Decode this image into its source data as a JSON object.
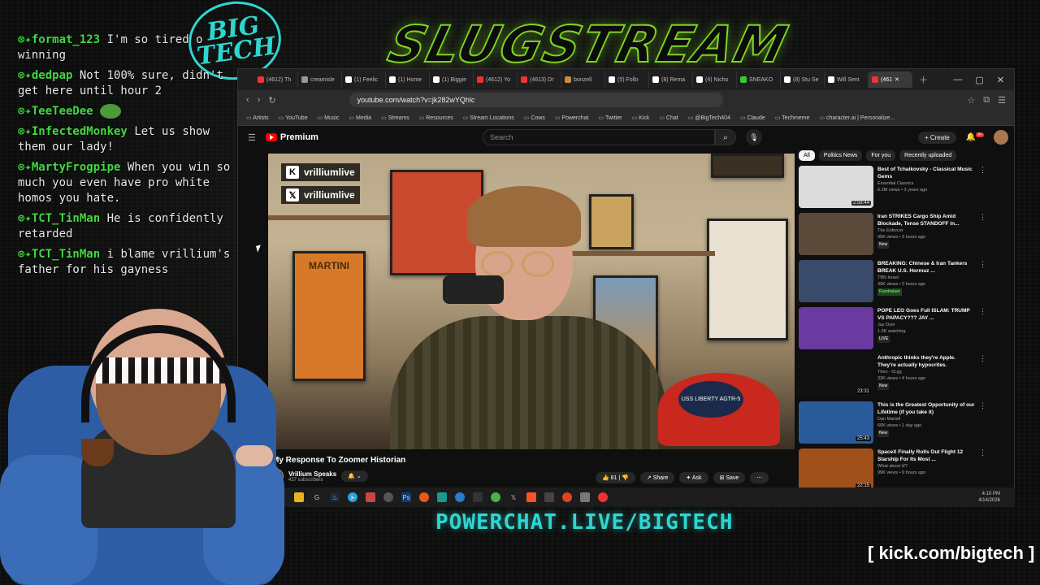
{
  "overlay": {
    "stream_title": "SLUGSTREAM",
    "logo_text": "BIG\nTECH",
    "powerchat": "POWERCHAT.LIVE/BIGTECH",
    "kick": "[ kick.com/bigtech ]"
  },
  "chat": [
    {
      "user": "format_123",
      "text": "I'm so tired o winning"
    },
    {
      "user": "dedpap",
      "text": "Not 100% sure, didn't get here until hour 2"
    },
    {
      "user": "TeeTeeDee",
      "text": ""
    },
    {
      "user": "InfectedMonkey",
      "text": "Let us show them our lady!"
    },
    {
      "user": "MartyFrogpipe",
      "text": "When you win so much you even have pro white homos you hate."
    },
    {
      "user": "TCT_TinMan",
      "text": "He is confidently retarded"
    },
    {
      "user": "TCT_TinMan",
      "text": "i blame vrillium's father for his gayness"
    }
  ],
  "browser": {
    "tabs": [
      "(4612) Th",
      "creamisle",
      "(1) Feelic",
      "(1) Home",
      "(1) Biggie",
      "(4612) Yo",
      "(4613) Dr",
      "bonzell",
      "(5) Follo",
      "(8) Rema",
      "(4) Nicho",
      "SNEAKO",
      "(8) Stu Se",
      "Will Sent",
      "(461"
    ],
    "url": "youtube.com/watch?v=jk282wYQhlc",
    "bookmarks": [
      "Artists",
      "YouTube",
      "Music",
      "Media",
      "Streams",
      "Resources",
      "Stream Locations",
      "Cows",
      "Powerchat",
      "Twitter",
      "Kick",
      "Chat",
      "@BigTech404",
      "Claude",
      "Techmeme",
      "character.ai | Personalize..."
    ]
  },
  "youtube": {
    "logo": "Premium",
    "search_placeholder": "Search",
    "create_label": "+ Create",
    "notif_count": "9+",
    "video": {
      "watermark_kick": "vrilliumlive",
      "watermark_x": "vrilliumlive",
      "hat_text": "USS LIBERTY AGTR-5",
      "poster_text": "MARTINI",
      "title": "My Response To Zoomer Historian",
      "channel": "Vrillium Speaks",
      "subs": "427 subscribers",
      "likes": "81",
      "share": "Share",
      "ask": "Ask",
      "save": "Save"
    },
    "chips": [
      "All",
      "Politics News",
      "For you",
      "Recently uploaded"
    ],
    "recs": [
      {
        "title": "Best of Tchaikovsky - Classical Music Gems",
        "channel": "Essential Classics",
        "meta": "6.2M views • 3 years ago",
        "dur": "2:59:44",
        "badge": "",
        "color": "#dcdcdc"
      },
      {
        "title": "Iran STRIKES Cargo Ship Amid Blockade, Tense STANDOFF in...",
        "channel": "The Enforcer",
        "meta": "95K views • 3 hours ago",
        "dur": "",
        "badge": "New",
        "color": "#5a4a3a"
      },
      {
        "title": "BREAKING: Chinese & Iran Tankers BREAK U.S. Hormuz ...",
        "channel": "TBN Israel",
        "meta": "39K views • 2 hours ago",
        "dur": "",
        "badge": "Fundraiser",
        "color": "#3a4a6a"
      },
      {
        "title": "POPE LEO Goes Full ISLAM: TRUMP VS PAPACY??? JAY ...",
        "channel": "Jay Dyer",
        "meta": "1.5K watching",
        "dur": "",
        "badge": "LIVE",
        "color": "#6a3aa0"
      },
      {
        "title": "Anthropic thinks they're Apple. They're actually hypocrites.",
        "channel": "Theo - t3.gg",
        "meta": "33K views • 4 hours ago",
        "dur": "23:31",
        "badge": "New",
        "color": "#111111"
      },
      {
        "title": "This is the Greatest Opportunity of our Lifetime (if you take it)",
        "channel": "Dan Martell",
        "meta": "60K views • 1 day ago",
        "dur": "25:43",
        "badge": "New",
        "color": "#2a5a9a"
      },
      {
        "title": "SpaceX Finally Rolls Out Flight 12 Starship For Its Most ...",
        "channel": "What about it!?",
        "meta": "99K views • 9 hours ago",
        "dur": "22:15",
        "badge": "",
        "color": "#a0501a"
      }
    ]
  },
  "taskbar": {
    "time": "4:10 PM",
    "date": "4/14/2026"
  },
  "colors": {
    "accent_green": "#7ed321",
    "accent_cyan": "#2fd6d0",
    "chat_user": "#43d843"
  }
}
